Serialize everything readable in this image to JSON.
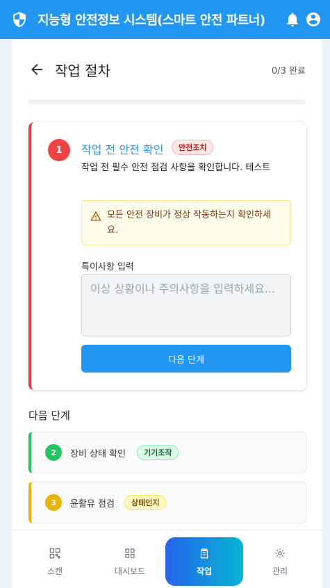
{
  "app": {
    "title": "지능형 안전정보 시스템(스마트 안전 파트너)",
    "icons": [
      "shield-icon",
      "bell-icon",
      "account-icon"
    ],
    "color": "#2196f3"
  },
  "header": {
    "title": "작업 절차",
    "progress_text": "0/3 완료",
    "progress_fraction": 0
  },
  "current_step": {
    "number": "1",
    "title": "작업 전 안전 확인",
    "badge": "안전조치",
    "description": "작업 전 필수 안전 점검 사항을 확인합니다. 테스트",
    "warning": "모든 안전 장비가 정상 작동하는지 확인하세요.",
    "note_label": "특이사항 입력",
    "note_placeholder": "이상 상황이나 주의사항을 입력하세요...",
    "note_value": "",
    "next_button": "다음 단계",
    "accent_color": "#e53e3e"
  },
  "next_steps": {
    "heading": "다음 단계",
    "items": [
      {
        "number": "2",
        "label": "장비 상태 확인",
        "badge": "기기조작",
        "color": "#22c55e"
      },
      {
        "number": "3",
        "label": "윤활유 점검",
        "badge": "상태인지",
        "color": "#eab308"
      }
    ]
  },
  "nav": {
    "items": [
      {
        "label": "스캔",
        "icon": "qr-scan-icon"
      },
      {
        "label": "대시보드",
        "icon": "dashboard-icon"
      },
      {
        "label": "작업",
        "icon": "clipboard-icon",
        "active": true
      },
      {
        "label": "관리",
        "icon": "gear-icon"
      }
    ]
  }
}
